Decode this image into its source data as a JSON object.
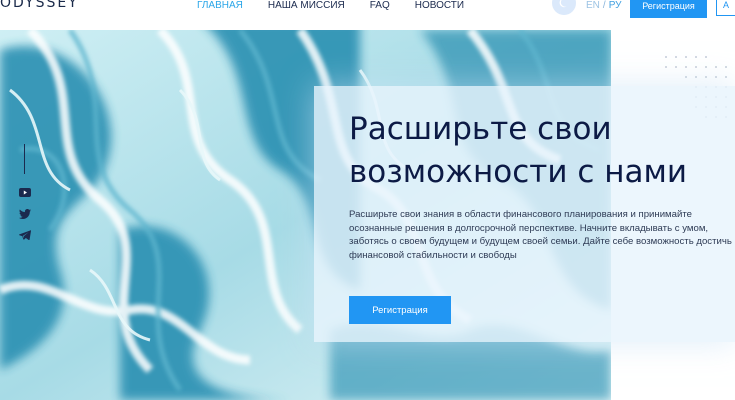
{
  "header": {
    "logo": "ODYSSEY",
    "nav": [
      {
        "label": "ГЛАВНАЯ",
        "active": true
      },
      {
        "label": "НАША МИССИЯ",
        "active": false
      },
      {
        "label": "FAQ",
        "active": false
      },
      {
        "label": "НОВОСТИ",
        "active": false
      }
    ],
    "theme_icon": "moon-icon",
    "lang": {
      "en": "EN",
      "separator": "/",
      "ru": "РУ"
    },
    "register_label": "Регистрация",
    "login_label": "А"
  },
  "hero": {
    "title_line1": "Расширьте свои",
    "title_line2": "возможности с нами",
    "description": "Расширьте свои знания в области финансового планирования и принимайте осознанные решения в долгосрочной перспективе. Начните вкладывать с умом, заботясь о своем будущем и будущем своей семьи. Дайте себе возможность достичь финансовой стабильности и свободы",
    "cta_label": "Регистрация"
  },
  "social": [
    {
      "icon": "youtube-icon"
    },
    {
      "icon": "twitter-icon"
    },
    {
      "icon": "telegram-icon"
    }
  ],
  "colors": {
    "accent": "#2196f3",
    "active_nav": "#2aa6e8",
    "title": "#0c1a45",
    "marble_dark": "#2a8fb0",
    "marble_light": "#bfe6ef"
  }
}
